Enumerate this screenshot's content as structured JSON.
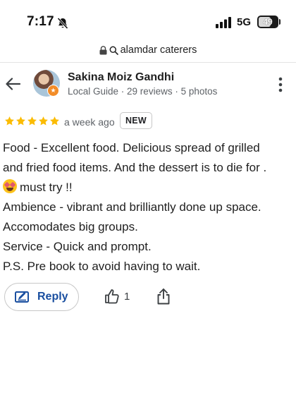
{
  "status_bar": {
    "time": "7:17",
    "network": "5G",
    "battery": "49",
    "icons": [
      "bell-slash-icon",
      "signal-bars-icon"
    ]
  },
  "browser": {
    "url": "alamdar caterers",
    "icons": [
      "lock-icon",
      "search-icon"
    ]
  },
  "review": {
    "author_name": "Sakina Moiz Gandhi",
    "author_meta": "Local Guide · 29 reviews · 5 photos",
    "rating": 5,
    "rating_max": 5,
    "time_ago": "a week ago",
    "badge": "NEW",
    "lines": [
      "Food - Excellent food. Delicious spread of grilled",
      "and fried food items. And the dessert is to die for .",
      "must try !!",
      "Ambience - vibrant and brilliantly done up space.",
      "Accomodates big groups.",
      "Service - Quick and prompt.",
      "P.S. Pre book to avoid having to wait."
    ],
    "emoji": "star-struck-emoji",
    "star_color": "#fbbc04"
  },
  "actions": {
    "reply_label": "Reply",
    "like_count": "1",
    "reply_color": "#1a4fa0"
  },
  "header_icons": [
    "back-arrow-icon",
    "more-vert-icon"
  ]
}
